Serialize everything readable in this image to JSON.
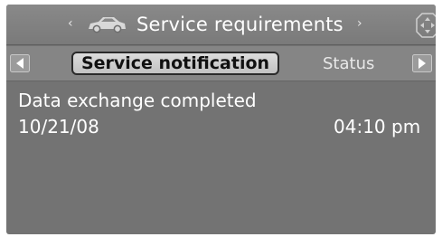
{
  "header": {
    "title": "Service requirements",
    "left_arrow": "‹",
    "right_arrow": "›",
    "title_icon": "car-icon",
    "corner_icon": "controller-icon"
  },
  "tabs": {
    "items": [
      {
        "label": "Service notification",
        "active": true
      },
      {
        "label": "Status",
        "active": false
      }
    ],
    "scroll_left_icon": "tab-scroll-left-icon",
    "scroll_right_icon": "tab-scroll-right-icon"
  },
  "content": {
    "message": "Data exchange completed",
    "date": "10/21/08",
    "time": "04:10 pm"
  },
  "colors": {
    "screen_bg": "#737373",
    "header_bg": "#898989",
    "tab_bar_bg": "#858585",
    "active_tab_bg": "#d0d0d0",
    "text": "#ffffff"
  }
}
